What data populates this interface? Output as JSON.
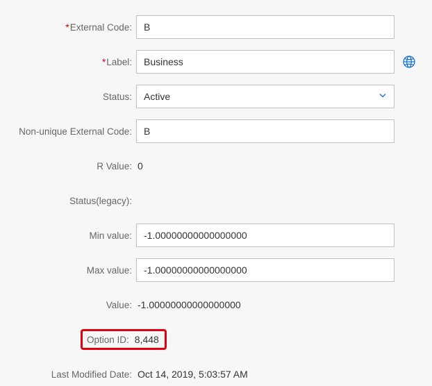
{
  "fields": {
    "externalCode": {
      "label": "External Code:",
      "value": "B",
      "required": true
    },
    "label": {
      "label": "Label:",
      "value": "Business",
      "required": true
    },
    "status": {
      "label": "Status:",
      "value": "Active"
    },
    "nonUniqueExternalCode": {
      "label": "Non-unique External Code:",
      "value": "B"
    },
    "rValue": {
      "label": "R Value:",
      "value": "0"
    },
    "statusLegacy": {
      "label": "Status(legacy):",
      "value": ""
    },
    "minValue": {
      "label": "Min value:",
      "value": "-1.00000000000000000"
    },
    "maxValue": {
      "label": "Max value:",
      "value": "-1.00000000000000000"
    },
    "value": {
      "label": "Value:",
      "value": "-1.00000000000000000"
    },
    "optionId": {
      "label": "Option ID:",
      "value": "8,448"
    },
    "lastModifiedDate": {
      "label": "Last Modified Date:",
      "value": "Oct 14, 2019, 5:03:57 AM"
    }
  },
  "colors": {
    "highlight": "#e3000f",
    "link": "#0a6ed1"
  }
}
